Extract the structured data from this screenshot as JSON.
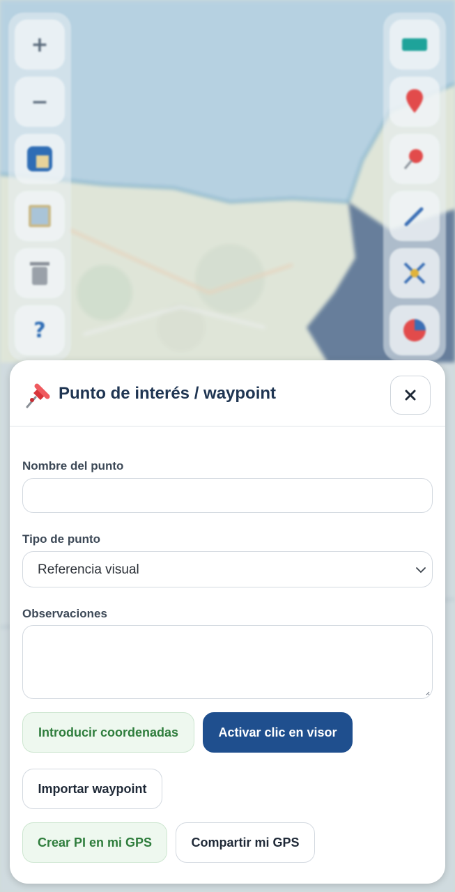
{
  "map": {
    "colors": {
      "sea": "#a3c6db",
      "land": "#dde3cf",
      "coast": "#4f93b7",
      "overlay": "#1e3f6e"
    },
    "left_toolbar": [
      "zoom-in-icon",
      "zoom-out-icon",
      "layers-icon",
      "map-sheet-icon",
      "trash-icon",
      "help-icon"
    ],
    "right_toolbar": [
      "ruler-icon",
      "map-marker-icon",
      "pushpin-icon",
      "draw-icon",
      "network-icon",
      "chart-icon"
    ]
  },
  "modal": {
    "title": "Punto de interés / waypoint",
    "icon": "pushpin-icon",
    "close_icon": "close-icon",
    "fields": {
      "name": {
        "label": "Nombre del punto",
        "value": ""
      },
      "type": {
        "label": "Tipo de punto",
        "selected": "Referencia visual"
      },
      "notes": {
        "label": "Observaciones",
        "value": ""
      }
    },
    "buttons": {
      "enter_coords": "Introducir coordenadas",
      "activate_click": "Activar clic en visor",
      "import_waypoint": "Importar waypoint",
      "create_poi_gps": "Crear PI en mi GPS",
      "share_gps": "Compartir mi GPS"
    }
  },
  "colors": {
    "title": "#1f3552",
    "primary": "#1f4f8e",
    "green_text": "#2e7d3c",
    "green_bg": "#eef8ef"
  }
}
